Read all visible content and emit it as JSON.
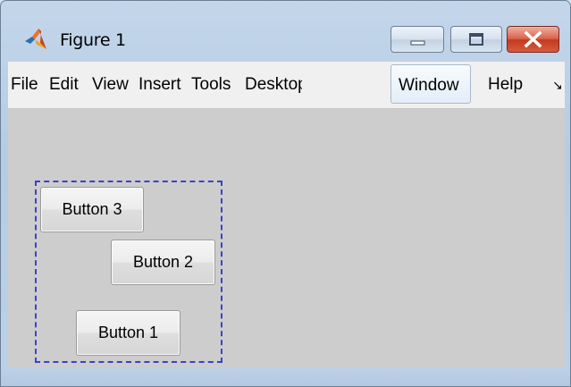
{
  "window": {
    "title": "Figure 1",
    "controls": {
      "minimize": "minimize",
      "maximize": "maximize",
      "close": "close"
    }
  },
  "menu": {
    "items": [
      "File",
      "Edit",
      "View",
      "Insert",
      "Tools",
      "Desktop",
      "Window",
      "Help"
    ],
    "active_item": "Window",
    "overflow_icon": "chevron-overflow-icon"
  },
  "figure": {
    "buttons": {
      "button3": "Button 3",
      "button2": "Button 2",
      "button1": "Button 1"
    },
    "selection_color": "#3a42c8",
    "background_color": "#cdcdcd"
  }
}
